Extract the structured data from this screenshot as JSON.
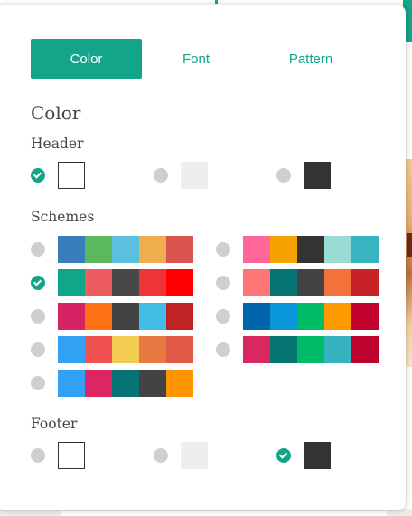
{
  "tabs": {
    "color": "Color",
    "font": "Font",
    "pattern": "Pattern"
  },
  "section_title": "Color",
  "header": {
    "title": "Header",
    "options": [
      {
        "swatch": "#ffffff",
        "checked": true
      },
      {
        "swatch": "#eeeeee",
        "checked": false
      },
      {
        "swatch": "#333333",
        "checked": false
      }
    ]
  },
  "schemes": {
    "title": "Schemes",
    "items": [
      {
        "colors": [
          "#3a7dbb",
          "#5cb85c",
          "#5bc0de",
          "#f0ad4e",
          "#d9534f"
        ],
        "checked": false
      },
      {
        "colors": [
          "#ff6699",
          "#f5a203",
          "#333333",
          "#99dcd6",
          "#38b3c2"
        ],
        "checked": false
      },
      {
        "colors": [
          "#10a689",
          "#ed5d5f",
          "#484848",
          "#ef3435",
          "#ff0000"
        ],
        "checked": true
      },
      {
        "colors": [
          "#ff7474",
          "#077474",
          "#434343",
          "#f3723b",
          "#c62228"
        ],
        "checked": false
      },
      {
        "colors": [
          "#d62364",
          "#ff7115",
          "#424242",
          "#41bde6",
          "#c02323"
        ],
        "checked": false
      },
      {
        "colors": [
          "#0065ad",
          "#0796d8",
          "#00bb68",
          "#ff9900",
          "#c2032f"
        ],
        "checked": false
      },
      {
        "colors": [
          "#32a0f5",
          "#ef5250",
          "#f3cd51",
          "#e67a42",
          "#e15a47"
        ],
        "checked": false
      },
      {
        "colors": [
          "#d92760",
          "#077474",
          "#00bb67",
          "#35b1c0",
          "#be042c"
        ],
        "checked": false
      },
      {
        "colors": [
          "#32a1f5",
          "#dc2563",
          "#067474",
          "#434343",
          "#ff9400"
        ],
        "checked": false
      }
    ]
  },
  "footer": {
    "title": "Footer",
    "options": [
      {
        "swatch": "#ffffff",
        "checked": false
      },
      {
        "swatch": "#eeeeee",
        "checked": false
      },
      {
        "swatch": "#333333",
        "checked": true
      }
    ]
  },
  "colors": {
    "accent": "#12a58a",
    "radio_unchecked": "#cfcfcf",
    "text": "#444444"
  }
}
